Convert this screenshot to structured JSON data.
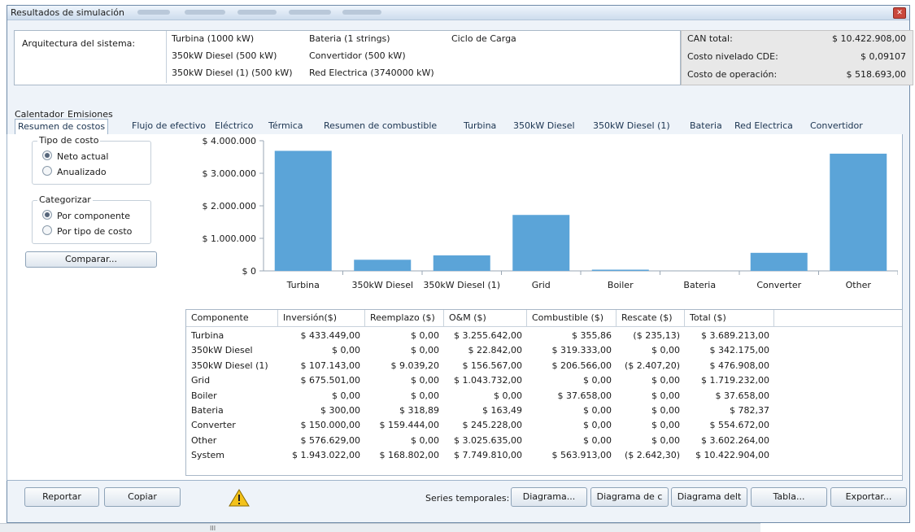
{
  "window": {
    "title": "Resultados de simulación"
  },
  "architecture": {
    "label": "Arquitectura del sistema:",
    "items": [
      "Turbina (1000 kW)",
      "Bateria (1 strings)",
      "Ciclo de Carga",
      "350kW Diesel (500 kW)",
      "Convertidor (500 kW)",
      "350kW Diesel (1) (500 kW)",
      "Red Electrica (3740000 kW)"
    ]
  },
  "summary": {
    "npc_label": "CAN total:",
    "npc_value": "$ 10.422.908,00",
    "coe_label": "Costo nivelado CDE:",
    "coe_value": "$ 0,09107",
    "op_label": "Costo de operación:",
    "op_value": "$ 518.693,00"
  },
  "outer_tabs": [
    "Calentador",
    "Emisiones"
  ],
  "tabs": [
    "Resumen de costos",
    "Flujo de efectivo",
    "Eléctrico",
    "Térmica",
    "Resumen de combustible",
    "Turbina",
    "350kW Diesel",
    "350kW Diesel (1)",
    "Bateria",
    "Red Electrica",
    "Convertidor"
  ],
  "cost_type": {
    "legend": "Tipo de costo",
    "options": [
      "Neto actual",
      "Anualizado"
    ],
    "selected": "Neto actual"
  },
  "categorize": {
    "legend": "Categorizar",
    "options": [
      "Por componente",
      "Por tipo de costo"
    ],
    "selected": "Por componente"
  },
  "compare_label": "Comparar...",
  "chart_data": {
    "type": "bar",
    "categories": [
      "Turbina",
      "350kW Diesel",
      "350kW Diesel (1)",
      "Grid",
      "Boiler",
      "Bateria",
      "Converter",
      "Other"
    ],
    "values": [
      3689213,
      342175,
      476908,
      1719232,
      37658,
      782,
      554672,
      3602264
    ],
    "yticks": [
      "$ 0",
      "$ 1.000.000",
      "$ 2.000.000",
      "$ 3.000.000",
      "$ 4.000.000"
    ],
    "ylim": [
      0,
      4000000
    ],
    "bar_color": "#5ba4d8"
  },
  "table": {
    "headers": [
      "Componente",
      "Inversión($)",
      "Reemplazo ($)",
      "O&M ($)",
      "Combustible ($)",
      "Rescate ($)",
      "Total ($)"
    ],
    "rows": [
      [
        "Turbina",
        "$ 433.449,00",
        "$ 0,00",
        "$ 3.255.642,00",
        "$ 355,86",
        "($ 235,13)",
        "$ 3.689.213,00"
      ],
      [
        "350kW Diesel",
        "$ 0,00",
        "$ 0,00",
        "$ 22.842,00",
        "$ 319.333,00",
        "$ 0,00",
        "$ 342.175,00"
      ],
      [
        "350kW Diesel (1)",
        "$ 107.143,00",
        "$ 9.039,20",
        "$ 156.567,00",
        "$ 206.566,00",
        "($ 2.407,20)",
        "$ 476.908,00"
      ],
      [
        "Grid",
        "$ 675.501,00",
        "$ 0,00",
        "$ 1.043.732,00",
        "$ 0,00",
        "$ 0,00",
        "$ 1.719.232,00"
      ],
      [
        "Boiler",
        "$ 0,00",
        "$ 0,00",
        "$ 0,00",
        "$ 37.658,00",
        "$ 0,00",
        "$ 37.658,00"
      ],
      [
        "Bateria",
        "$ 300,00",
        "$ 318,89",
        "$ 163,49",
        "$ 0,00",
        "$ 0,00",
        "$ 782,37"
      ],
      [
        "Converter",
        "$ 150.000,00",
        "$ 159.444,00",
        "$ 245.228,00",
        "$ 0,00",
        "$ 0,00",
        "$ 554.672,00"
      ],
      [
        "Other",
        "$ 576.629,00",
        "$ 0,00",
        "$ 3.025.635,00",
        "$ 0,00",
        "$ 0,00",
        "$ 3.602.264,00"
      ],
      [
        "System",
        "$ 1.943.022,00",
        "$ 168.802,00",
        "$ 7.749.810,00",
        "$ 563.913,00",
        "($ 2.642,30)",
        "$ 10.422.904,00"
      ]
    ]
  },
  "bottom": {
    "report": "Reportar",
    "copy": "Copiar",
    "series_label": "Series temporales:",
    "diagram": "Diagrama...",
    "diagram_c": "Diagrama de c",
    "diagram_d": "Diagrama delt",
    "table": "Tabla...",
    "export": "Exportar..."
  },
  "scrollbar": {
    "grip": "III"
  }
}
